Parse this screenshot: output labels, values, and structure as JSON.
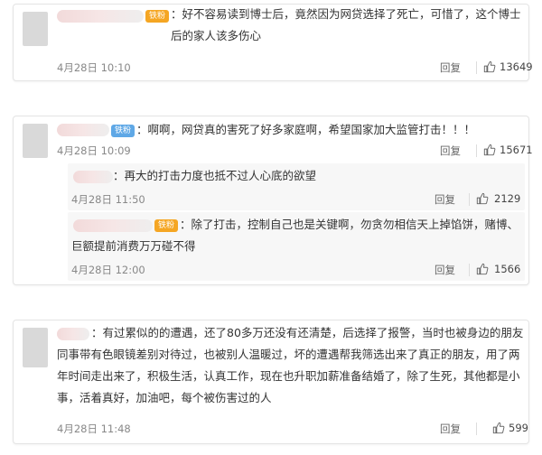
{
  "comments": [
    {
      "badge": "铁粉",
      "text": "：好不容易读到博士后，竟然因为网贷选择了死亡，可惜了，这个博士后的家人该多伤心",
      "date": "4月28日 10:10",
      "reply": "回复",
      "likes": "13649"
    },
    {
      "badge": "铁粉",
      "text": "：啊啊，网贷真的害死了好多家庭啊，希望国家加大监管打击！！！",
      "date": "4月28日 10:09",
      "reply": "回复",
      "likes": "15671",
      "replies": [
        {
          "text": "：再大的打击力度也抵不过人心底的欲望",
          "date": "4月28日 11:50",
          "reply": "回复",
          "likes": "2129"
        },
        {
          "badge": "铁粉",
          "text": "：除了打击，控制自己也是关键啊，勿贪勿相信天上掉馅饼，赌博、巨额提前消费万万碰不得",
          "date": "4月28日 12:00",
          "reply": "回复",
          "likes": "1566"
        }
      ]
    },
    {
      "text": "：有过累似的的遭遇，还了80多万还没有还清楚，后选择了报警，当时也被身边的朋友同事带有色眼镜差别对待过，也被别人温暖过，坏的遭遇帮我筛选出来了真正的朋友，用了两年时间走出来了，积极生活，认真工作，现在也升职加薪准备结婚了，除了生死，其他都是小事，活着真好，加油吧，每个被伤害过的人",
      "date": "4月28日 11:48",
      "reply": "回复",
      "likes": "599"
    }
  ],
  "colors": {
    "orange_badge": "#f5a623",
    "blue_badge": "#5fa8e6"
  },
  "icons": {
    "like": "thumbs-up-icon"
  }
}
